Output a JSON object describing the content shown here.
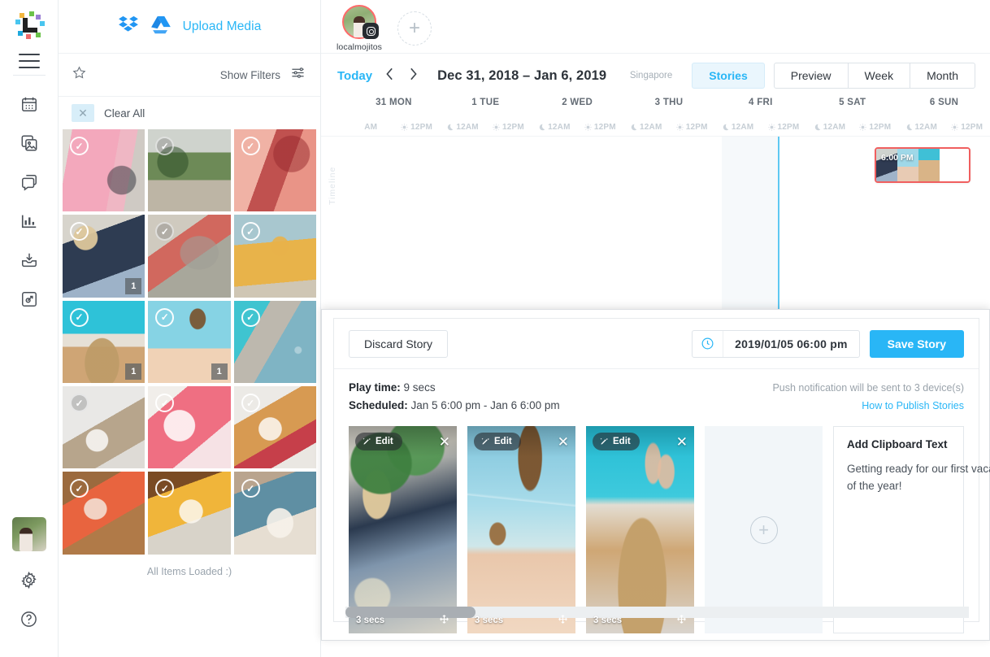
{
  "app": {
    "brand": "Later"
  },
  "sidebar": {
    "menu_label": "menu",
    "items": [
      {
        "name": "calendar",
        "label": "Calendar"
      },
      {
        "name": "media",
        "label": "Media Library"
      },
      {
        "name": "conversations",
        "label": "Conversations"
      },
      {
        "name": "analytics",
        "label": "Analytics"
      },
      {
        "name": "collect",
        "label": "Collect Media"
      },
      {
        "name": "linkinbio",
        "label": "Link in Bio"
      }
    ],
    "bottom": [
      {
        "name": "account-avatar",
        "label": "Account"
      },
      {
        "name": "settings",
        "label": "Settings"
      },
      {
        "name": "help",
        "label": "Help"
      }
    ]
  },
  "media_panel": {
    "upload_label": "Upload Media",
    "sources": [
      "dropbox-icon",
      "google-drive-icon"
    ],
    "star_label": "Favorites",
    "show_filters_label": "Show Filters",
    "clear_all_label": "Clear All",
    "all_loaded_label": "All Items Loaded :)",
    "tiles": [
      {
        "id": 1,
        "alt": "pink wall with chair",
        "selected": true,
        "badge": ""
      },
      {
        "id": 2,
        "alt": "tropical patio plants",
        "selected": true,
        "badge": ""
      },
      {
        "id": 3,
        "alt": "coral pink interior",
        "selected": true,
        "badge": ""
      },
      {
        "id": 4,
        "alt": "packed suitcase flatlay",
        "selected": true,
        "badge": "1"
      },
      {
        "id": 5,
        "alt": "palm leaf and surfboard",
        "selected": true,
        "badge": ""
      },
      {
        "id": 6,
        "alt": "woman in yellow dress",
        "selected": true,
        "badge": ""
      },
      {
        "id": 7,
        "alt": "legs by the pool",
        "selected": true,
        "badge": "1"
      },
      {
        "id": 8,
        "alt": "palm tree on beach",
        "selected": true,
        "badge": "1"
      },
      {
        "id": 9,
        "alt": "aerial beach umbrellas",
        "selected": true,
        "badge": ""
      },
      {
        "id": 10,
        "alt": "breakfast with coffee pot",
        "selected": true,
        "badge": ""
      },
      {
        "id": 11,
        "alt": "strawberry smoothie bowl",
        "selected": true,
        "badge": ""
      },
      {
        "id": 12,
        "alt": "waffle with jam",
        "selected": true,
        "badge": ""
      },
      {
        "id": 13,
        "alt": "bruschetta on board",
        "selected": true,
        "badge": ""
      },
      {
        "id": 14,
        "alt": "eggs and toast breakfast",
        "selected": true,
        "badge": ""
      },
      {
        "id": 15,
        "alt": "ricotta toast on blue plate",
        "selected": true,
        "badge": ""
      }
    ]
  },
  "header": {
    "profile": {
      "username": "localmojitos",
      "network": "instagram-icon",
      "unread_ring": true
    },
    "add_profile_label": "+"
  },
  "calendar": {
    "today_label": "Today",
    "prev_label": "‹",
    "next_label": "›",
    "date_range": "Dec 31, 2018 – Jan 6, 2019",
    "timezone": "Singapore",
    "views": [
      {
        "label": "Stories",
        "active": true
      },
      {
        "label": "Preview",
        "active": false
      },
      {
        "label": "Week",
        "active": false
      },
      {
        "label": "Month",
        "active": false
      }
    ],
    "days": [
      "31 MON",
      "1 TUE",
      "2 WED",
      "3 THU",
      "4 FRI",
      "5 SAT",
      "6 SUN"
    ],
    "ticks": [
      {
        "label": "AM",
        "icon": "none"
      },
      {
        "label": "12PM",
        "icon": "sun"
      },
      {
        "label": "12AM",
        "icon": "moon"
      },
      {
        "label": "12PM",
        "icon": "sun"
      },
      {
        "label": "12AM",
        "icon": "moon"
      },
      {
        "label": "12PM",
        "icon": "sun"
      },
      {
        "label": "12AM",
        "icon": "moon"
      },
      {
        "label": "12PM",
        "icon": "sun"
      },
      {
        "label": "12AM",
        "icon": "moon"
      },
      {
        "label": "12PM",
        "icon": "sun"
      },
      {
        "label": "12AM",
        "icon": "moon"
      },
      {
        "label": "12PM",
        "icon": "sun"
      },
      {
        "label": "12AM",
        "icon": "moon"
      },
      {
        "label": "12PM",
        "icon": "sun"
      }
    ],
    "timeline_label": "Timeline",
    "scheduled_block": {
      "time_label": "6:00 PM",
      "slide_count": 3,
      "highlighted": true
    }
  },
  "editor": {
    "discard_label": "Discard Story",
    "clock_icon": "clock-icon",
    "datetime_value": "2019/01/05 06:00 pm",
    "save_label": "Save Story",
    "play_time_label": "Play time:",
    "play_time_value": "9 secs",
    "scheduled_label": "Scheduled:",
    "scheduled_value": "Jan 5 6:00 pm - Jan 6 6:00 pm",
    "push_note": "Push notification will be sent to 3 device(s)",
    "help_link": "How to Publish Stories",
    "slides": [
      {
        "edit_label": "Edit",
        "duration": "3 secs",
        "alt": "packed suitcase flatlay"
      },
      {
        "edit_label": "Edit",
        "duration": "3 secs",
        "alt": "palm tree on beach"
      },
      {
        "edit_label": "Edit",
        "duration": "3 secs",
        "alt": "legs by the pool"
      }
    ],
    "add_slide_label": "+",
    "clipboard": {
      "title": "Add Clipboard Text",
      "text": "Getting ready for our first vaca\nof the year!"
    }
  },
  "colors": {
    "accent": "#29b6f6",
    "story_block_border": "#f05f5f",
    "now_line": "#5ec8f2",
    "text_dark": "#2d333a",
    "text_muted": "#9aa3ab"
  }
}
